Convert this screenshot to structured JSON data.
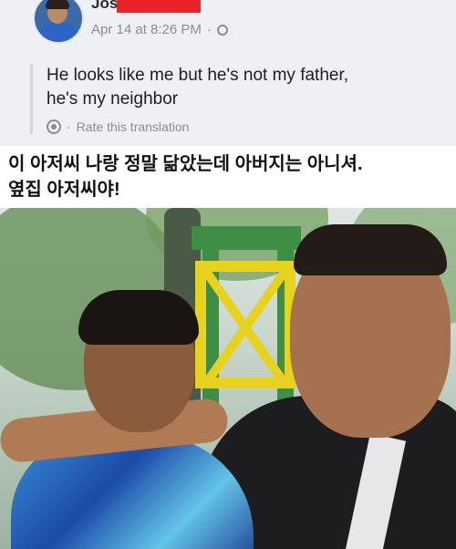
{
  "post": {
    "author_name": "Jos",
    "timestamp": "Apr 14 at 8:26 PM",
    "separator": "·",
    "text_line1": "He looks like me but he's not my father,",
    "text_line2": "he's my neighbor",
    "rate_translation": "Rate this translation",
    "icons": [
      "avatar",
      "globe-icon",
      "gear-icon"
    ]
  },
  "caption": {
    "line1": "이 아저씨 나랑 정말 닮았는데 아버지는 아니셔.",
    "line2": "옆집 아저씨야!"
  },
  "colors": {
    "redaction": "#e8242a",
    "caption_bg": "#ffffff",
    "post_bg": "#eef0f3"
  }
}
